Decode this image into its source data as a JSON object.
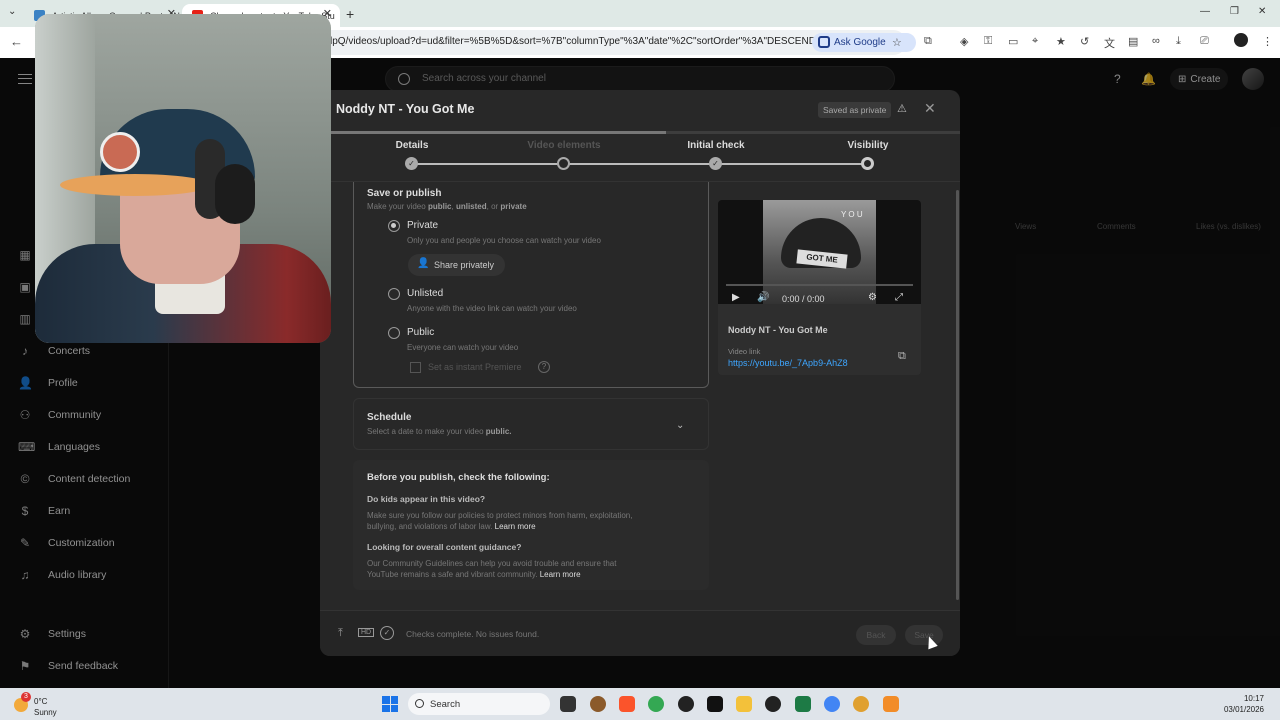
{
  "browser": {
    "tabs": [
      {
        "title": "Artistic Album Covers | Poster N",
        "favicon_color": "#3b82c4"
      },
      {
        "title": "Channel content - YouTube Stu",
        "favicon_color": "#e62117"
      }
    ],
    "url": "lpQ/videos/upload?d=ud&filter=%5B%5D&sort=%7B\"columnType\"%3A\"date\"%2C\"sortOrder\"%3A\"DESCENDIN...",
    "ask_google": "Ask Google"
  },
  "yt_header": {
    "search_placeholder": "Search across your channel",
    "create_label": "Create"
  },
  "sidebar": {
    "items": [
      {
        "label": "Concerts",
        "icon": "mic-icon"
      },
      {
        "label": "Profile",
        "icon": "profile-icon"
      },
      {
        "label": "Community",
        "icon": "community-icon"
      },
      {
        "label": "Languages",
        "icon": "languages-icon"
      },
      {
        "label": "Content detection",
        "icon": "copyright-icon"
      },
      {
        "label": "Earn",
        "icon": "dollar-icon"
      },
      {
        "label": "Customization",
        "icon": "wand-icon"
      },
      {
        "label": "Audio library",
        "icon": "audio-library-icon"
      }
    ],
    "settings": "Settings",
    "feedback": "Send feedback"
  },
  "table_columns": [
    "Views",
    "Comments",
    "Likes (vs. dislikes)"
  ],
  "modal": {
    "title": "Noddy NT - You Got Me",
    "saved_badge": "Saved as private",
    "progress": 0.54,
    "steps": [
      {
        "label": "Details",
        "state": "done"
      },
      {
        "label": "Video elements",
        "state": "dim"
      },
      {
        "label": "Initial check",
        "state": "done"
      },
      {
        "label": "Visibility",
        "state": "current"
      }
    ],
    "save_publish": {
      "heading": "Save or publish",
      "sub_prefix": "Make your video",
      "opt_public": "public",
      "opt_unlisted": "unlisted",
      "sub_or": ", or",
      "opt_private": "private"
    },
    "options": [
      {
        "label": "Private",
        "desc": "Only you and people you choose can watch your video",
        "selected": true
      },
      {
        "label": "Unlisted",
        "desc": "Anyone with the video link can watch your video",
        "selected": false
      },
      {
        "label": "Public",
        "desc": "Everyone can watch your video",
        "selected": false
      }
    ],
    "share_privately": "Share privately",
    "instant_premiere": "Set as instant Premiere",
    "schedule": {
      "heading": "Schedule",
      "sub_prefix": "Select a date to make your video",
      "sub_bold": "public."
    },
    "prepublish": {
      "heading": "Before you publish, check the following:",
      "q1": "Do kids appear in this video?",
      "a1": "Make sure you follow our policies to protect minors from harm, exploitation, bullying, and violations of labor law.",
      "q2": "Looking for overall content guidance?",
      "a2": "Our Community Guidelines can help you avoid trouble and ensure that YouTube remains a safe and vibrant community.",
      "learn_more": "Learn more"
    },
    "video": {
      "thumb_text": "GOT ME",
      "thumb_top": "Y O U",
      "time": "0:00 / 0:00",
      "title": "Noddy NT - You Got Me",
      "link_label": "Video link",
      "link": "https://youtu.be/_7Apb9-AhZ8"
    },
    "footer": {
      "hd_badge": "HD",
      "status": "Checks complete. No issues found.",
      "back": "Back",
      "save": "Save"
    }
  },
  "taskbar": {
    "temp": "0°C",
    "condition": "Sunny",
    "weather_badge": "3",
    "search": "Search",
    "time": "10:17",
    "date": "03/01/2026"
  }
}
